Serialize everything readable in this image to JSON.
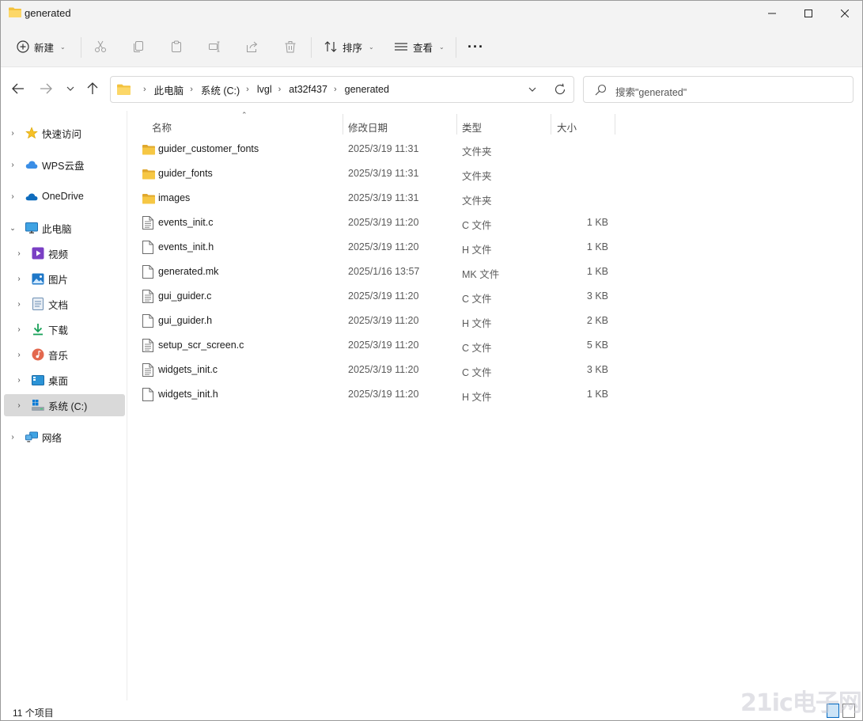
{
  "window": {
    "title": "generated",
    "controls": [
      "minimize-icon",
      "maximize-icon",
      "close-icon"
    ]
  },
  "toolbar": {
    "new_label": "新建",
    "sort_label": "排序",
    "view_label": "查看",
    "more_label": "···",
    "icons": [
      "cut-icon",
      "copy-icon",
      "paste-icon",
      "rename-icon",
      "share-icon",
      "delete-icon"
    ]
  },
  "address": {
    "crumbs": [
      "此电脑",
      "系统 (C:)",
      "lvgl",
      "at32f437",
      "generated"
    ]
  },
  "search": {
    "placeholder": "搜索\"generated\""
  },
  "sidebar": {
    "items": [
      {
        "label": "快速访问",
        "icon": "star-icon"
      },
      {
        "label": "WPS云盘",
        "icon": "cloud-icon"
      },
      {
        "label": "OneDrive",
        "icon": "onedrive-icon"
      },
      {
        "label": "此电脑",
        "icon": "computer-icon"
      },
      {
        "label": "视频",
        "icon": "video-icon"
      },
      {
        "label": "图片",
        "icon": "picture-icon"
      },
      {
        "label": "文档",
        "icon": "document-icon"
      },
      {
        "label": "下载",
        "icon": "download-icon"
      },
      {
        "label": "音乐",
        "icon": "music-icon"
      },
      {
        "label": "桌面",
        "icon": "desktop-icon"
      },
      {
        "label": "系统 (C:)",
        "icon": "drive-icon"
      },
      {
        "label": "网络",
        "icon": "network-icon"
      }
    ]
  },
  "columns": {
    "name": "名称",
    "date": "修改日期",
    "type": "类型",
    "size": "大小"
  },
  "files": [
    {
      "name": "guider_customer_fonts",
      "date": "2025/3/19 11:31",
      "type": "文件夹",
      "size": "",
      "kind": "folder"
    },
    {
      "name": "guider_fonts",
      "date": "2025/3/19 11:31",
      "type": "文件夹",
      "size": "",
      "kind": "folder"
    },
    {
      "name": "images",
      "date": "2025/3/19 11:31",
      "type": "文件夹",
      "size": "",
      "kind": "folder"
    },
    {
      "name": "events_init.c",
      "date": "2025/3/19 11:20",
      "type": "C 文件",
      "size": "1 KB",
      "kind": "code"
    },
    {
      "name": "events_init.h",
      "date": "2025/3/19 11:20",
      "type": "H 文件",
      "size": "1 KB",
      "kind": "file"
    },
    {
      "name": "generated.mk",
      "date": "2025/1/16 13:57",
      "type": "MK 文件",
      "size": "1 KB",
      "kind": "file"
    },
    {
      "name": "gui_guider.c",
      "date": "2025/3/19 11:20",
      "type": "C 文件",
      "size": "3 KB",
      "kind": "code"
    },
    {
      "name": "gui_guider.h",
      "date": "2025/3/19 11:20",
      "type": "H 文件",
      "size": "2 KB",
      "kind": "file"
    },
    {
      "name": "setup_scr_screen.c",
      "date": "2025/3/19 11:20",
      "type": "C 文件",
      "size": "5 KB",
      "kind": "code"
    },
    {
      "name": "widgets_init.c",
      "date": "2025/3/19 11:20",
      "type": "C 文件",
      "size": "3 KB",
      "kind": "code"
    },
    {
      "name": "widgets_init.h",
      "date": "2025/3/19 11:20",
      "type": "H 文件",
      "size": "1 KB",
      "kind": "file"
    }
  ],
  "status": {
    "item_count": "11 个项目"
  },
  "watermark": "21ic电子网",
  "colors": {
    "folder": "#f3c23d",
    "selected_nav": "#d9d9d9",
    "chrome": "#f3f3f3"
  }
}
